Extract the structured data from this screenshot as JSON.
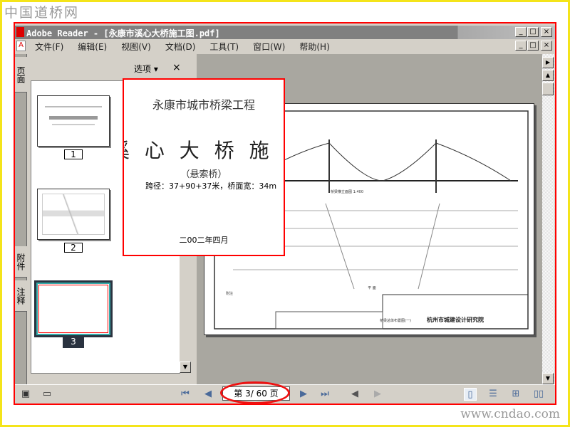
{
  "watermarks": {
    "top_left": "中国道桥网",
    "bottom_right": "www.cndao.com"
  },
  "window": {
    "title": "Adobe Reader - [永康市溪心大桥施工图.pdf]",
    "minimize": "_",
    "maximize": "□",
    "close": "×"
  },
  "menu": [
    "文件(F)",
    "编辑(E)",
    "视图(V)",
    "文档(D)",
    "工具(T)",
    "窗口(W)",
    "帮助(H)"
  ],
  "side_tabs": [
    "页面",
    "附件",
    "注释"
  ],
  "panel": {
    "options_label": "选项 ▾",
    "close": "×"
  },
  "thumbnails": [
    {
      "label": "1"
    },
    {
      "label": "2"
    },
    {
      "label": "3",
      "selected": true
    }
  ],
  "popup": {
    "project": "永康市城市桥梁工程",
    "title": "溪 心 大 桥 施 工",
    "subtitle": "（悬索桥）",
    "spec": "跨径：37+90+37米，桥面宽：34m",
    "date": "二00二年四月"
  },
  "drawing": {
    "institute": "杭州市城建设计研究院",
    "sheet_title": "桥梁总体布置图(一)",
    "plan_label": "平 面",
    "elevation_label": "桥梁横立面图 1:400",
    "notes_label": "附注"
  },
  "navigation": {
    "page_display": "第 3/ 60 页",
    "current_page": 3,
    "total_pages": 60
  },
  "colors": {
    "highlight": "#ff0000",
    "border": "#f4e41a",
    "selected_thumb": "#2a3340"
  }
}
